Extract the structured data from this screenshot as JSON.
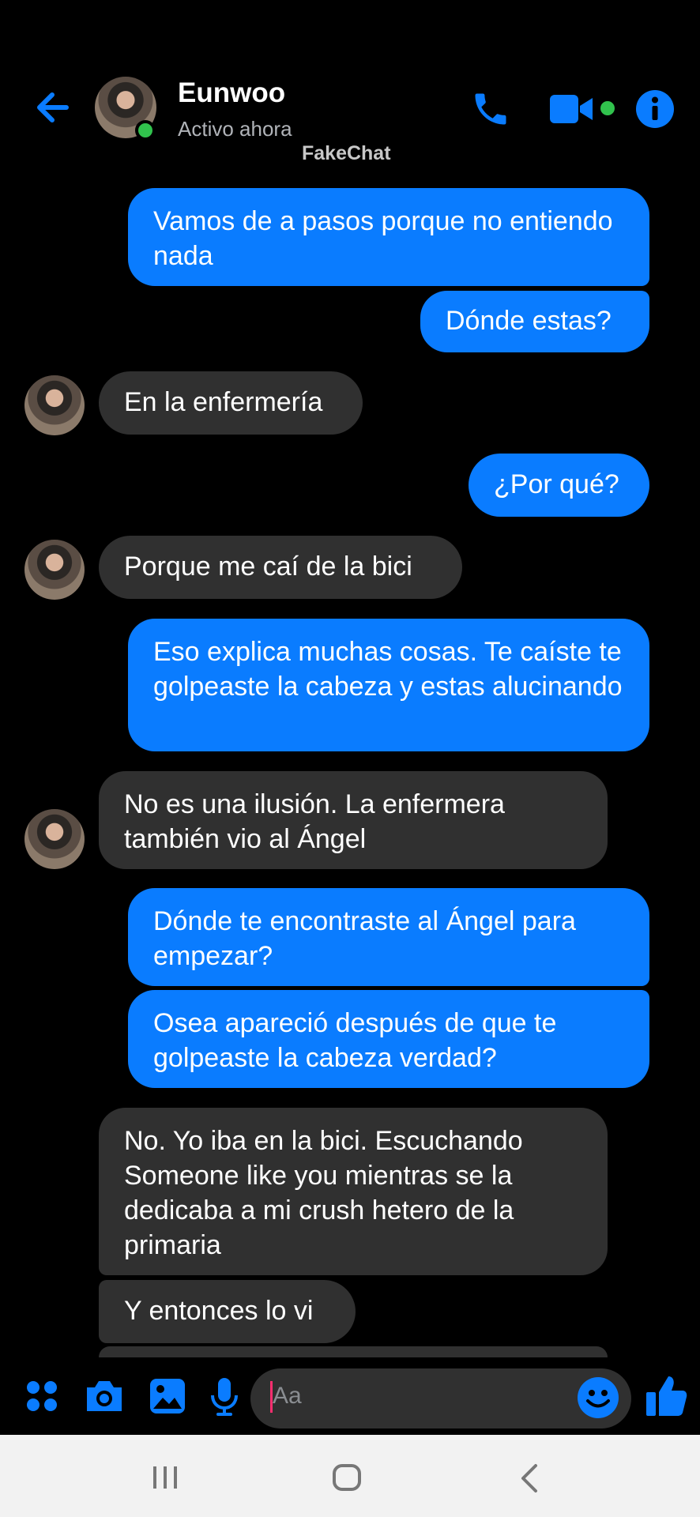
{
  "header": {
    "contact_name": "Eunwoo",
    "status": "Activo ahora",
    "watermark": "FakeChat"
  },
  "messages": [
    {
      "side": "out",
      "text": "Vamos de a pasos porque no entiendo nada"
    },
    {
      "side": "out",
      "text": "Dónde estas?"
    },
    {
      "side": "in",
      "text": "En la enfermería"
    },
    {
      "side": "out",
      "text": "¿Por qué?"
    },
    {
      "side": "in",
      "text": "Porque me caí de la bici"
    },
    {
      "side": "out",
      "text": "Eso explica muchas cosas. Te caíste te golpeaste la cabeza y estas alucinando"
    },
    {
      "side": "in",
      "text": "No es una ilusión. La enfermera también vio al Ángel"
    },
    {
      "side": "out",
      "text": "Dónde te encontraste al Ángel para empezar?"
    },
    {
      "side": "out",
      "text": "Osea apareció después de que te golpeaste la cabeza verdad?"
    },
    {
      "side": "in",
      "text": "No. Yo iba en la bici. Escuchando Someone like you mientras se la dedicaba a mi crush hetero de la primaria"
    },
    {
      "side": "in",
      "text": "Y entonces lo vi"
    }
  ],
  "composer": {
    "placeholder": "Aa"
  },
  "colors": {
    "accent": "#0a7cff",
    "incoming_bubble": "#303030",
    "online": "#31c24d",
    "background": "#000000"
  },
  "icons": [
    "back-arrow-icon",
    "phone-icon",
    "video-camera-icon",
    "info-icon",
    "menu-dots-icon",
    "camera-icon",
    "gallery-icon",
    "microphone-icon",
    "emoji-icon",
    "thumbs-up-icon",
    "recent-apps-icon",
    "home-icon",
    "back-icon"
  ]
}
